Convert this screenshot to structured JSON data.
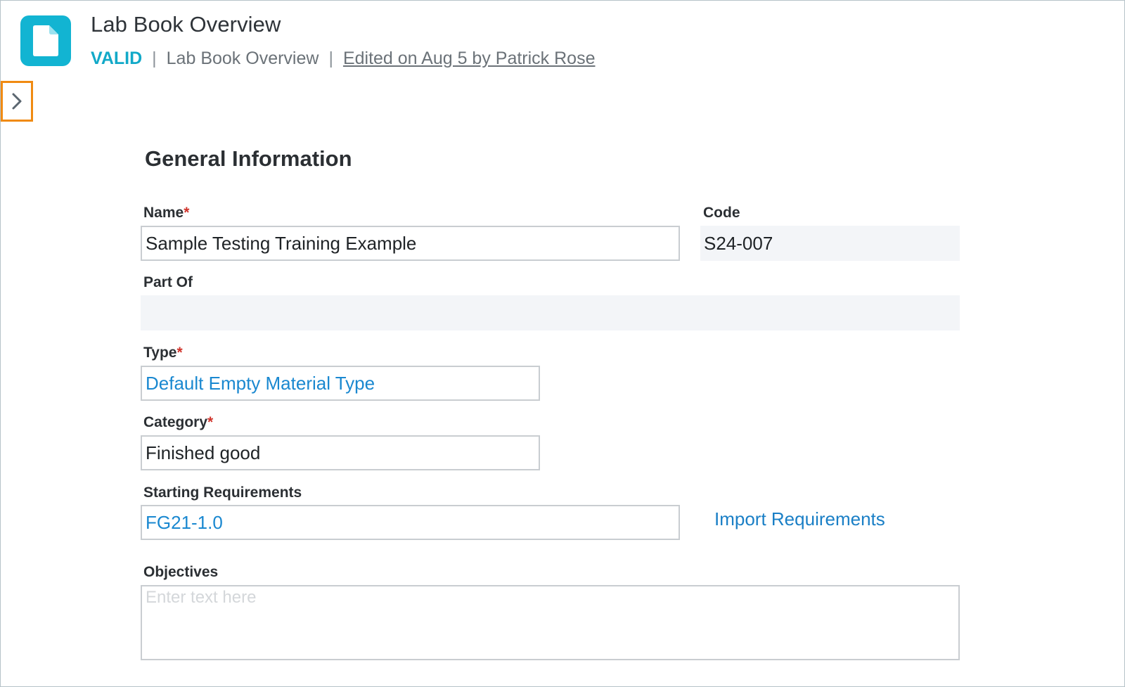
{
  "header": {
    "title": "Lab Book Overview",
    "status": "VALID",
    "separator": "|",
    "breadcrumb": "Lab Book Overview",
    "edited": "Edited on Aug 5 by Patrick Rose",
    "icon": "document-icon"
  },
  "sidebar_toggle": {
    "icon": "chevron-right-icon"
  },
  "section": {
    "title": "General Information"
  },
  "form": {
    "name": {
      "label": "Name",
      "required": "*",
      "value": "Sample Testing Training Example"
    },
    "code": {
      "label": "Code",
      "value": "S24-007"
    },
    "part_of": {
      "label": "Part Of",
      "value": ""
    },
    "type": {
      "label": "Type",
      "required": "*",
      "value": "Default Empty Material Type"
    },
    "category": {
      "label": "Category",
      "required": "*",
      "value": "Finished good"
    },
    "starting_requirements": {
      "label": "Starting Requirements",
      "value": "FG21-1.0"
    },
    "import_requirements": "Import Requirements",
    "objectives": {
      "label": "Objectives",
      "placeholder": "Enter text here",
      "value": ""
    }
  },
  "colors": {
    "accent": "#12b4d2",
    "link": "#1a88d0",
    "required": "#d0332b",
    "highlight": "#f08a12"
  }
}
